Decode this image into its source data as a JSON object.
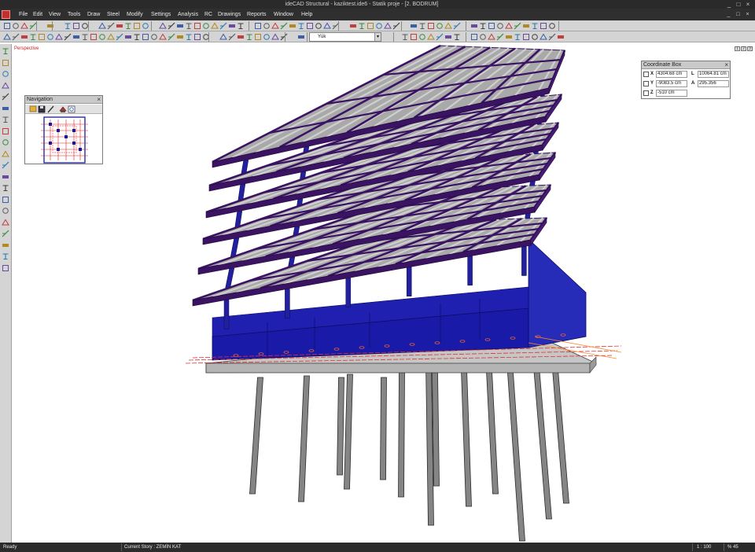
{
  "window": {
    "title": "ideCAD Structural - kaziktest.ide6 - Statik proje - [2. BODRUM]",
    "controls": [
      "_",
      "□",
      "×"
    ],
    "mdi_controls": [
      "_",
      "□",
      "×"
    ]
  },
  "menu": [
    "File",
    "Edit",
    "View",
    "Tools",
    "Draw",
    "Steel",
    "Modify",
    "Settings",
    "Analysis",
    "RC",
    "Drawings",
    "Reports",
    "Window",
    "Help"
  ],
  "toolbar": {
    "load_case": "Yük"
  },
  "viewport": {
    "label": "Perspective",
    "buttons": [
      "1",
      "2",
      "3"
    ]
  },
  "navigation": {
    "title": "Navigation",
    "close": "×"
  },
  "coordinate_box": {
    "title": "Coordinate Box",
    "close": "×",
    "x_label": "X",
    "x_value": "4304.68 cm",
    "y_label": "Y",
    "y_value": "-9083.5 cm",
    "z_label": "Z",
    "z_value": "-510 cm",
    "l_label": "L",
    "l_value": "10064.81 cm",
    "a_label": "A",
    "a_value": "295.356"
  },
  "statusbar": {
    "ready": "Ready",
    "current_story": "Current Story : ZEMİN KAT",
    "scale": "1 : 100",
    "zoom": "% 45"
  },
  "colors": {
    "slab": "#3a1363",
    "column": "#23209e",
    "wall": "#1a1aa8",
    "beam": "#8f8f8f",
    "raft": "#b4b4b4",
    "pile": "#858585",
    "ui_dark": "#2a2a2a",
    "ui_light": "#d4d4d4"
  }
}
